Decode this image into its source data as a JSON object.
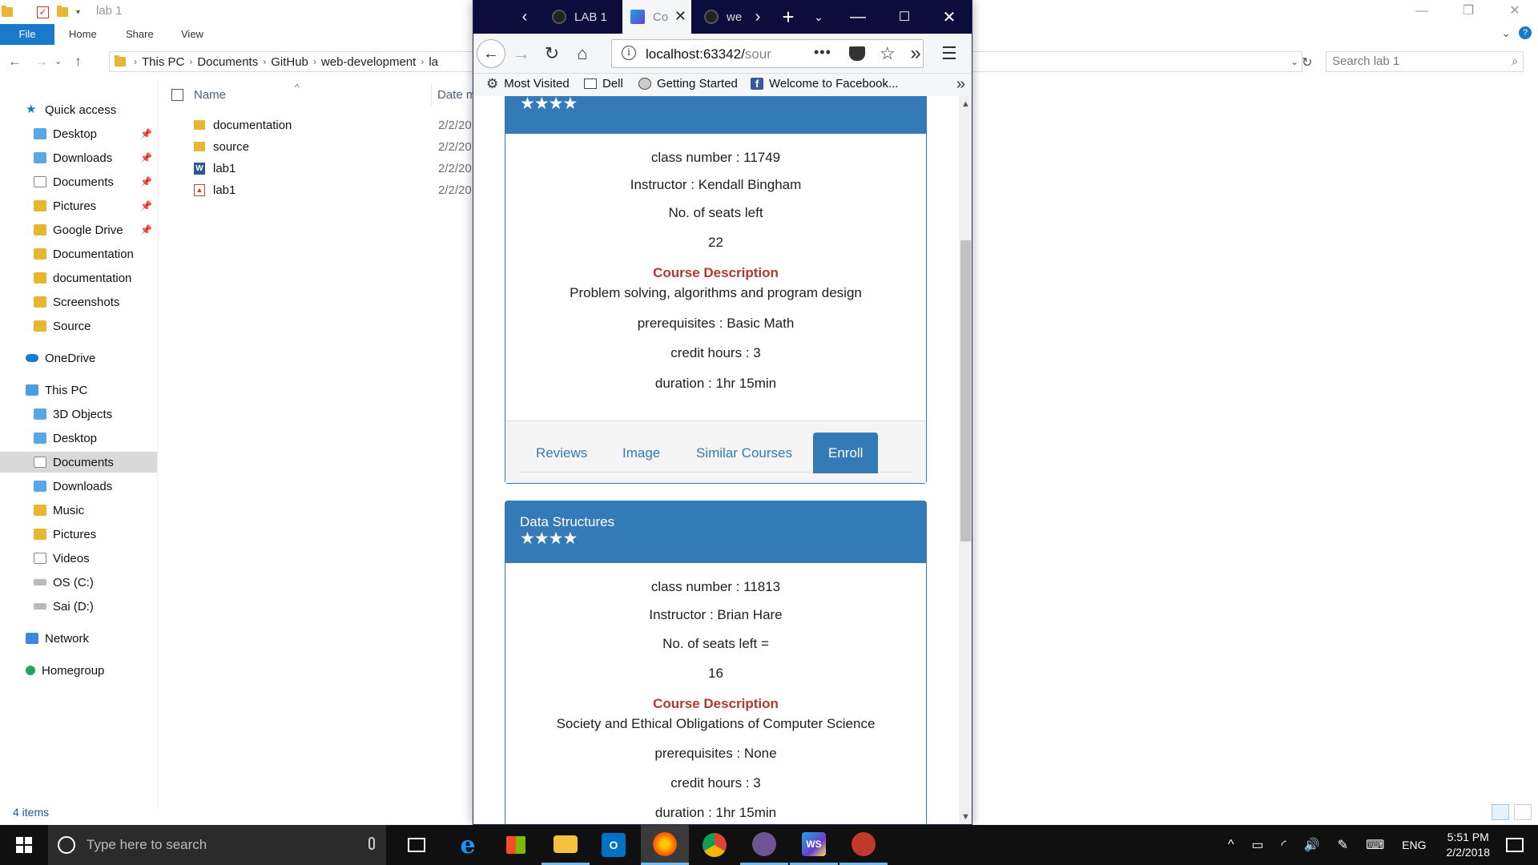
{
  "explorer": {
    "window_title": "lab 1",
    "ribbon_tabs": [
      "File",
      "Home",
      "Share",
      "View"
    ],
    "breadcrumb": [
      "This PC",
      "Documents",
      "GitHub",
      "web-development",
      "la"
    ],
    "search_placeholder": "Search lab 1",
    "nav": {
      "quick_access": "Quick access",
      "quick_items": [
        "Desktop",
        "Downloads",
        "Documents",
        "Pictures",
        "Google Drive",
        "Documentation",
        "documentation",
        "Screenshots",
        "Source"
      ],
      "onedrive": "OneDrive",
      "this_pc": "This PC",
      "pc_items": [
        "3D Objects",
        "Desktop",
        "Documents",
        "Downloads",
        "Music",
        "Pictures",
        "Videos",
        "OS (C:)",
        "Sai (D:)"
      ],
      "network": "Network",
      "homegroup": "Homegroup"
    },
    "columns": {
      "name": "Name",
      "date": "Date m"
    },
    "files": [
      {
        "name": "documentation",
        "date": "2/2/20",
        "icon": "folder-icon"
      },
      {
        "name": "source",
        "date": "2/2/20",
        "icon": "folder-icon"
      },
      {
        "name": "lab1",
        "date": "2/2/20",
        "icon": "word-doc-icon"
      },
      {
        "name": "lab1",
        "date": "2/2/20",
        "icon": "pdf-icon"
      }
    ],
    "status": "4 items"
  },
  "browser": {
    "tabs": [
      {
        "label": "LAB 1",
        "icon": "github-icon"
      },
      {
        "label": "Co",
        "icon": "webstorm-icon"
      },
      {
        "label": "we",
        "icon": "github-icon"
      }
    ],
    "url_host": "localhost:63342/",
    "url_path": "sour",
    "bookmarks": [
      "Most Visited",
      "Dell",
      "Getting Started",
      "Welcome to Facebook..."
    ],
    "accent": "#337ab7",
    "courses": [
      {
        "title": "",
        "stars": "★★★★",
        "class_number": "class number : 11749",
        "instructor": "Instructor : Kendall Bingham",
        "seats_label": "No. of seats left",
        "seats": "22",
        "desc_title": "Course Description",
        "description": "Problem solving, algorithms and program design",
        "prerequisites": "prerequisites : Basic Math",
        "credit_hours": "credit hours : 3",
        "duration": "duration : 1hr 15min",
        "tabs": [
          "Reviews",
          "Image",
          "Similar Courses",
          "Enroll"
        ]
      },
      {
        "title": "Data Structures",
        "stars": "★★★★",
        "class_number": "class number : 11813",
        "instructor": "Instructor : Brian Hare",
        "seats_label": "No. of seats left =",
        "seats": "16",
        "desc_title": "Course Description",
        "description": "Society and Ethical Obligations of Computer Science",
        "prerequisites": "prerequisites : None",
        "credit_hours": "credit hours : 3",
        "duration": "duration : 1hr 15min"
      }
    ]
  },
  "taskbar": {
    "search_placeholder": "Type here to search",
    "language": "ENG",
    "time": "5:51 PM",
    "date": "2/2/2018"
  }
}
